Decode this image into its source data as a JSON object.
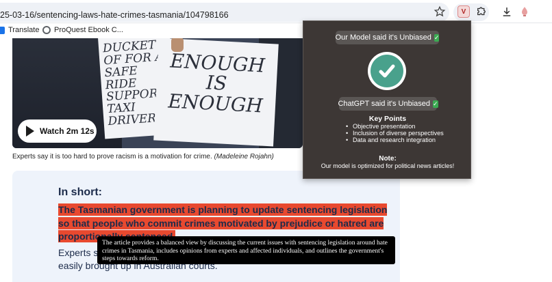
{
  "browser": {
    "url": "25-03-16/sentencing-laws-hate-crimes-tasmania/104798166",
    "bookmarks": [
      {
        "label": "Translate",
        "icon": "translate-icon"
      },
      {
        "label": "ProQuest Ebook C...",
        "icon": "globe-icon"
      }
    ],
    "extension_badge": "V"
  },
  "article": {
    "video": {
      "sign_left": "DUCKET OF FOR A SAFE RIDE SUPPORT TAXI DRIVERS",
      "sign_right": "ENOUGH IS ENOUGH",
      "watch_label": "Watch 2m 12s"
    },
    "caption": {
      "text": "Experts say it is too hard to prove racism is a motivation for crime.",
      "credit": "(Madeleine Rojahn)"
    },
    "in_short": {
      "title": "In short:",
      "highlight_line_1": "The Tasmanian government is planning to update sentencing legislation",
      "highlight_line_2": "so that people who commit crimes motivated by prejudice or hatred are",
      "highlight_line_3": "proportionally sentenced.",
      "body_line_1": "Experts s",
      "body_line_2": "easily brought up in Australian courts."
    }
  },
  "tooltip": {
    "text": "The article provides a balanced view by discussing the current issues with sentencing legislation around hate crimes in Tasmania, includes opinions from experts and affected individuals, and outlines the government's steps towards reform."
  },
  "popup": {
    "model_verdict": "Our Model said it's Unbiased",
    "chatgpt_verdict": "ChatGPT said it's Unbiased",
    "key_points_title": "Key Points",
    "key_points": [
      "Objective presentation",
      "Inclusion of diverse perspectives",
      "Data and research integration"
    ],
    "note_title": "Note:",
    "note_text": "Our model is optimized for political news articles!",
    "colors": {
      "panel": "#3d3735",
      "check": "#49a18c",
      "pill": "#5a5654"
    }
  },
  "colors": {
    "highlight": "#e8492f",
    "card": "#eef3fb"
  }
}
